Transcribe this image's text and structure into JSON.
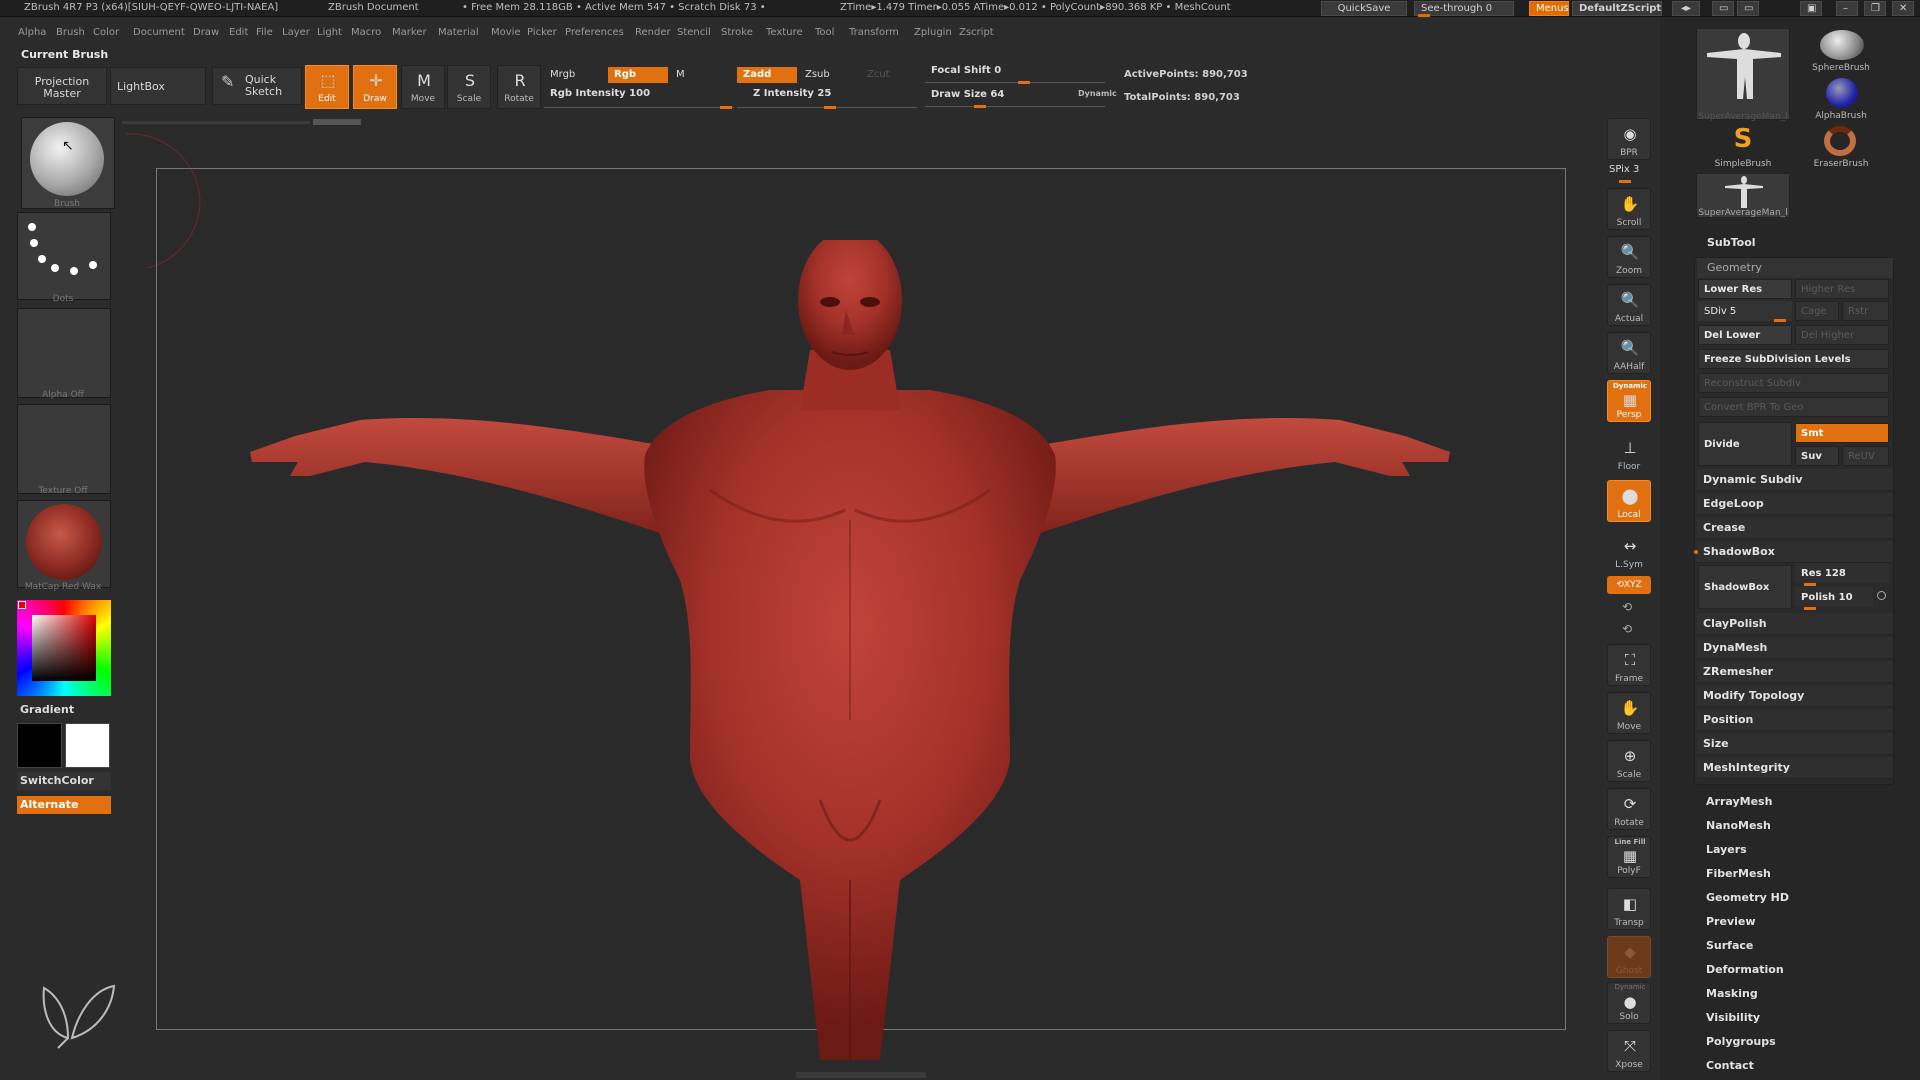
{
  "titlebar": {
    "app": "ZBrush 4R7 P3 (x64)[SIUH-QEYF-QWEO-LJTI-NAEA]",
    "doc": "ZBrush Document",
    "stats": "• Free Mem 28.118GB • Active Mem 547 • Scratch Disk 73 •",
    "times": "ZTime▸1.479 Timer▸0.055 ATime▸0.012 • PolyCount▸890.368 KP • MeshCount",
    "quicksave": "QuickSave",
    "seethrough": "See-through  0",
    "menus": "Menus",
    "script": "DefaultZScript"
  },
  "menu": [
    "Alpha",
    "Brush",
    "Color",
    "Document",
    "Draw",
    "Edit",
    "File",
    "Layer",
    "Light",
    "Macro",
    "Marker",
    "Material",
    "Movie",
    "Picker",
    "Preferences",
    "Render",
    "Stencil",
    "Stroke",
    "Texture",
    "Tool",
    "Transform",
    "Zplugin",
    "Zscript"
  ],
  "current_brush": "Current Brush",
  "toolbar": {
    "projection_master": "Projection Master",
    "lightbox": "LightBox",
    "quick_sketch": "Quick Sketch",
    "edit": "Edit",
    "draw": "Draw",
    "move": "Move",
    "scale": "Scale",
    "rotate": "Rotate",
    "mrgb": "Mrgb",
    "rgb": "Rgb",
    "m": "M",
    "rgb_intensity": "Rgb Intensity 100",
    "zadd": "Zadd",
    "zsub": "Zsub",
    "zcut": "Zcut",
    "z_intensity": "Z Intensity 25",
    "focal_shift": "Focal Shift 0",
    "draw_size": "Draw Size 64",
    "dynamic": "Dynamic",
    "active_points": "ActivePoints: 890,703",
    "total_points": "TotalPoints: 890,703"
  },
  "left": {
    "brush": "Brush",
    "dots": "Dots",
    "alpha": "Alpha Off",
    "texture": "Texture Off",
    "material": "MatCap Red Wax",
    "gradient": "Gradient",
    "switchcolor": "SwitchColor",
    "alternate": "Alternate"
  },
  "right_shelf": {
    "bpr": "BPR",
    "spix": "SPix 3",
    "scroll": "Scroll",
    "zoom": "Zoom",
    "actual": "Actual",
    "aahalf": "AAHalf",
    "dynamic": "Dynamic",
    "persp": "Persp",
    "floor": "Floor",
    "local": "Local",
    "lsym": "L.Sym",
    "xyz": "⟲XYZ",
    "frame": "Frame",
    "move": "Move",
    "scale": "Scale",
    "rotate": "Rotate",
    "linefill": "Line Fill",
    "polyf": "PolyF",
    "transp": "Transp",
    "ghost": "Ghost",
    "dynamic2": "Dynamic",
    "solo": "Solo",
    "xpose": "Xpose"
  },
  "tray": {
    "brushes": [
      {
        "label": "SuperAverageMan_l"
      },
      {
        "label": "SphereBrush"
      },
      {
        "label": "AlphaBrush"
      },
      {
        "label": "SimpleBrush"
      },
      {
        "label": "EraserBrush"
      },
      {
        "label": "SuperAverageMan_l"
      }
    ],
    "subtool": "SubTool",
    "geometry": "Geometry",
    "lower_res": "Lower Res",
    "higher_res": "Higher Res",
    "sdiv": "SDiv 5",
    "cage": "Cage",
    "rstr": "Rstr",
    "del_lower": "Del Lower",
    "del_higher": "Del Higher",
    "freeze": "Freeze SubDivision Levels",
    "reconstruct": "Reconstruct Subdiv",
    "convert_bpr": "Convert BPR To Geo",
    "divide": "Divide",
    "smt": "Smt",
    "suv": "Suv",
    "reuv": "ReUV",
    "dynamic_subdiv": "Dynamic Subdiv",
    "edgeloop": "EdgeLoop",
    "crease": "Crease",
    "shadowbox": "ShadowBox",
    "shadowbox2": "ShadowBox",
    "res": "Res 128",
    "polish": "Polish 10",
    "claypolish": "ClayPolish",
    "dynamesh": "DynaMesh",
    "zremesher": "ZRemesher",
    "modify_topology": "Modify Topology",
    "position": "Position",
    "size": "Size",
    "meshintegrity": "MeshIntegrity",
    "sections": [
      "ArrayMesh",
      "NanoMesh",
      "Layers",
      "FiberMesh",
      "Geometry HD",
      "Preview",
      "Surface",
      "Deformation",
      "Masking",
      "Visibility",
      "Polygroups",
      "Contact"
    ]
  },
  "colors": {
    "accent": "#e07010",
    "model": "#a9302a",
    "background": "#2a2a2a"
  }
}
